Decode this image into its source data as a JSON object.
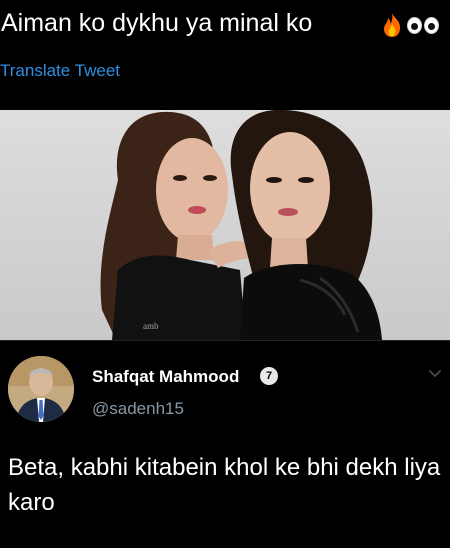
{
  "tweet": {
    "text": "Aiman ko dykhu ya minal ko",
    "emojis": [
      "fire-emoji",
      "eyes-emoji"
    ],
    "translate_label": "Translate Tweet",
    "image_watermark": "amb"
  },
  "reply": {
    "name": "Shafqat Mahmood",
    "badge": "7",
    "handle": "@sadenh15",
    "text": "Beta, kabhi kitabein khol ke bhi dekh liya karo"
  },
  "colors": {
    "background": "#000000",
    "text": "#ffffff",
    "link": "#2f8fe0",
    "handle": "#8899a6"
  }
}
